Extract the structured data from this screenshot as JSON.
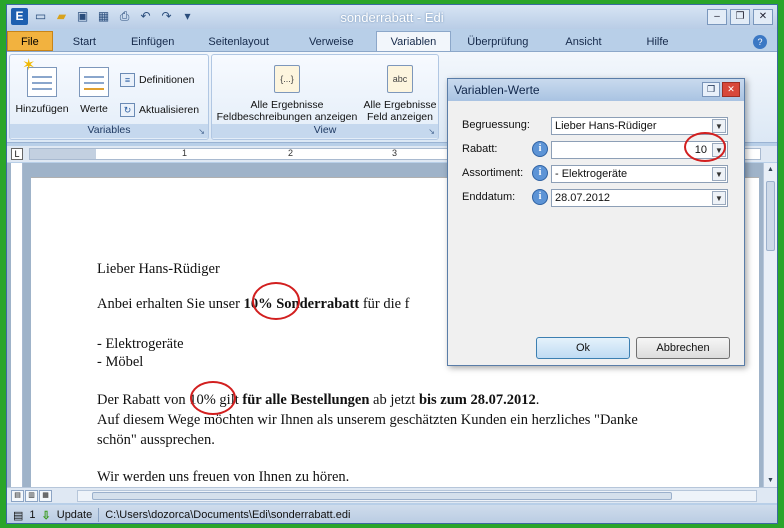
{
  "window": {
    "title": "sonderrabatt - Edi",
    "quick_access": [
      "app-icon",
      "new-doc-icon",
      "open-folder-icon",
      "save-icon",
      "save-all-icon",
      "print-icon",
      "undo-icon",
      "redo-icon",
      "customize-icon"
    ],
    "app_icon_letter": "E",
    "controls": [
      "minimize",
      "restore",
      "close"
    ]
  },
  "tabs": [
    "File",
    "Start",
    "Einfügen",
    "Seitenlayout",
    "Verweise",
    "Variablen",
    "Überprüfung",
    "Ansicht",
    "Hilfe"
  ],
  "active_tab": "Variablen",
  "ribbon": {
    "variables_group": {
      "label": "Variables",
      "add": "Hinzufügen",
      "values": "Werte",
      "definitions": "Definitionen",
      "refresh": "Aktualisieren"
    },
    "view_group": {
      "label": "View",
      "show_field_desc_1": "Alle Ergebnisse",
      "show_field_desc_2": "Feldbeschreibungen anzeigen",
      "show_field_1": "Alle Ergebnisse",
      "show_field_2": "Feld anzeigen",
      "field_icon_1": "{...}",
      "field_icon_2": "abc"
    }
  },
  "ruler": {
    "corner": "L",
    "numbers": [
      "1",
      "2",
      "3"
    ]
  },
  "document": {
    "line1": "Lieber Hans-Rüdiger",
    "line2_a": "Anbei  erhalten Sie unser ",
    "line2_b": "10% Sonderrabatt",
    "line2_c": " für die f",
    "line3": "- Elektrogeräte",
    "line4": "- Möbel",
    "line5_a": "Der Rabatt von ",
    "line5_b": "10% gilt ",
    "line5_c": "für alle Bestellungen",
    "line5_d": " ab jetzt ",
    "line5_e": "bis zum 28.07.2012",
    "line5_f": ".",
    "line6": "Auf diesem Wege möchten wir Ihnen als unserem geschätzten Kunden ein herzliches \"Danke",
    "line7": "schön\" aussprechen.",
    "line8": "Wir werden uns freuen von Ihnen zu hören."
  },
  "status": {
    "page": "1",
    "update_label": "Update",
    "path": "C:\\Users\\dozorca\\Documents\\Edi\\sonderrabatt.edi"
  },
  "dialog": {
    "title": "Variablen-Werte",
    "fields": [
      {
        "label": "Begruessung:",
        "value": "Lieber Hans-Rüdiger",
        "info": false,
        "align": "left"
      },
      {
        "label": "Rabatt:",
        "value": "10",
        "info": true,
        "align": "right"
      },
      {
        "label": "Assortiment:",
        "value": "- Elektrogeräte",
        "info": true,
        "align": "left"
      },
      {
        "label": "Enddatum:",
        "value": "28.07.2012",
        "info": true,
        "align": "left"
      }
    ],
    "ok_label": "Ok",
    "cancel_label": "Abbrechen"
  },
  "colors": {
    "highlight_circle": "#d21f1f",
    "file_tab": "#f2b23f",
    "outer_border": "#2aa52a"
  }
}
